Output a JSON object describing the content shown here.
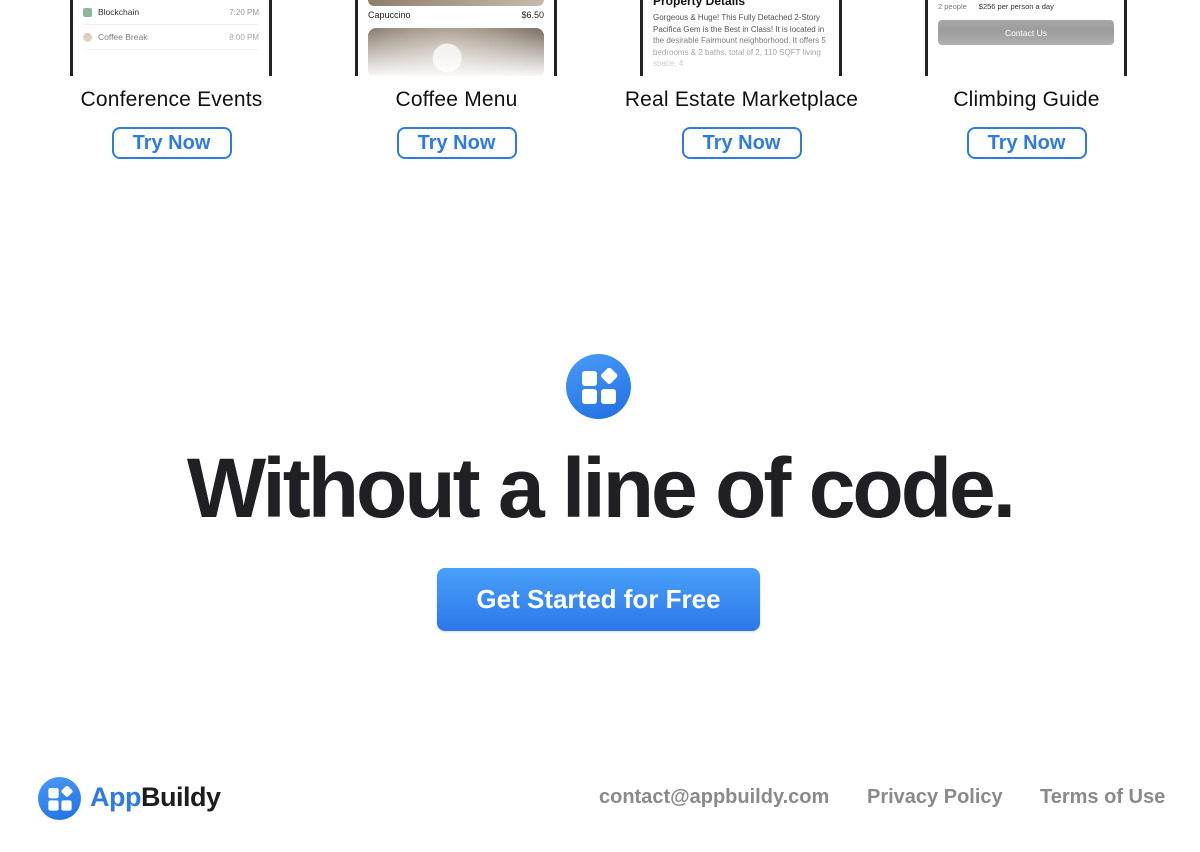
{
  "templates": [
    {
      "title": "Conference Events",
      "button": "Try Now",
      "preview": {
        "rows": [
          {
            "label": "Blockchain",
            "time": "7:20 PM"
          },
          {
            "label": "Coffee Break",
            "time": "8:00 PM"
          }
        ]
      }
    },
    {
      "title": "Coffee Menu",
      "button": "Try Now",
      "preview": {
        "item": "Capuccino",
        "price": "$6.50"
      }
    },
    {
      "title": "Real Estate Marketplace",
      "button": "Try Now",
      "preview": {
        "heading": "Property Details",
        "description": "Gorgeous & Huge! This Fully Detached 2-Story Pacifica Gem is the Best in Class! It is located in the desirable Fairmount neighborhood. It offers 5 bedrooms & 2 baths, total of 2, 110 SQFT living space, 4"
      }
    },
    {
      "title": "Climbing Guide",
      "button": "Try Now",
      "preview": {
        "people": "2 people",
        "price": "$256 per person a day",
        "contact": "Contact Us"
      }
    }
  ],
  "hero": {
    "headline": "Without a line of code.",
    "cta": "Get Started for Free"
  },
  "footer": {
    "brand_part1": "App",
    "brand_part2": "Buildy",
    "email": "contact@appbuildy.com",
    "privacy": "Privacy Policy",
    "terms": "Terms of Use"
  },
  "colors": {
    "accent": "#2f7be6",
    "headline": "#202024",
    "footer_link": "#8a8a8e"
  },
  "icons": [
    "blocks-logo-icon",
    "chevron-icon",
    "coffee-cup-icon"
  ]
}
